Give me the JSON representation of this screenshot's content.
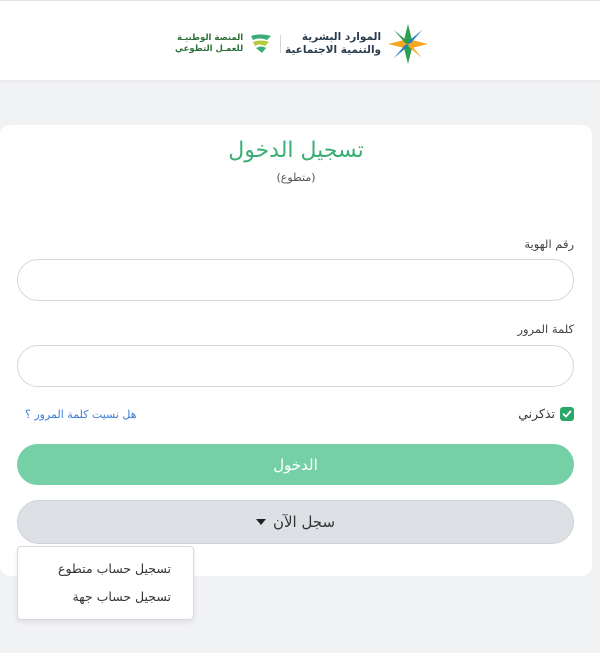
{
  "header": {
    "hr_logo": {
      "line1": "الموارد البشرية",
      "line2": "والتنمية الاجتماعية"
    },
    "nvp_logo": {
      "line1": "المنصة الوطنيـة",
      "line2": "للعمـل التطوعي"
    }
  },
  "login": {
    "title": "تسجيل الدخول",
    "subtitle": "(متطوع)",
    "id_label": "رقم الهوية",
    "id_value": "",
    "password_label": "كلمة المرور",
    "password_value": "",
    "remember_label": "تذكرني",
    "remember_checked": true,
    "forgot_link": "هل نسيت كلمة المرور ؟",
    "login_button": "الدخول",
    "register_button": "سجل الآن"
  },
  "register_menu": {
    "items": [
      {
        "label": "تسجيل حساب متطوع"
      },
      {
        "label": "تسجيل حساب جهة"
      }
    ]
  },
  "colors": {
    "brand_green": "#3aae74",
    "login_button": "#76d0a6",
    "link_blue": "#3b7dd8",
    "checkbox": "#2aa86a"
  }
}
